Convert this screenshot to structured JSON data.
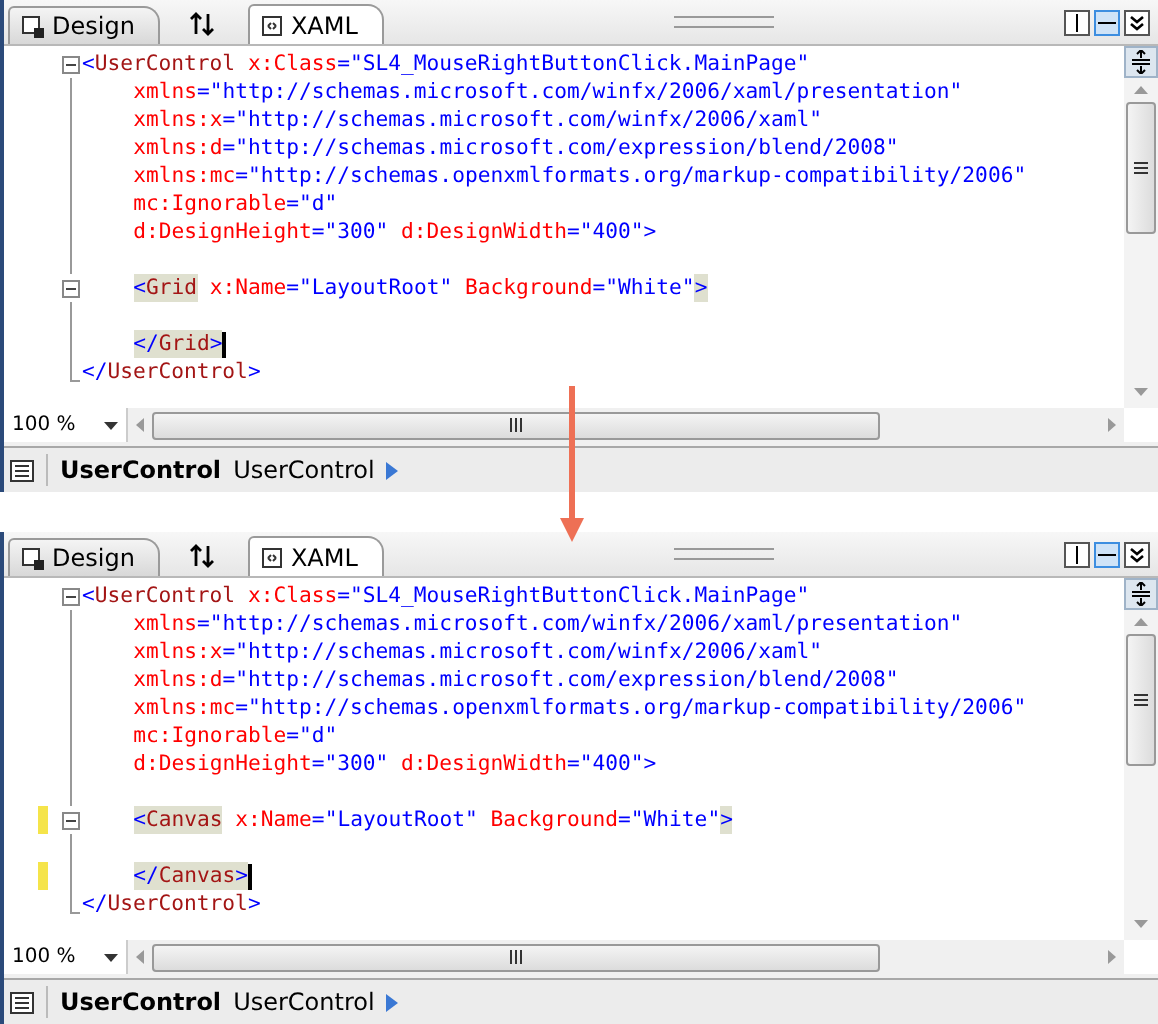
{
  "panels": [
    {
      "tabs": [
        {
          "label": "Design",
          "selected": false,
          "kind": "design"
        },
        {
          "label": "XAML",
          "selected": true,
          "kind": "xaml"
        }
      ],
      "lines": [
        {
          "kind": "fold_start",
          "indented": false,
          "changed": false,
          "tokens": [
            {
              "text": "<",
              "kind": "bracket"
            },
            {
              "text": "UserControl",
              "kind": "name"
            },
            {
              "text": " x:Class",
              "kind": "attr"
            },
            {
              "text": "=",
              "kind": "bracket"
            },
            {
              "text": "\"SL4_MouseRightButtonClick.MainPage\"",
              "kind": "value"
            }
          ]
        },
        {
          "kind": "fold_body",
          "indented": true,
          "changed": false,
          "tokens": [
            {
              "text": "xmlns",
              "kind": "attr"
            },
            {
              "text": "=",
              "kind": "bracket"
            },
            {
              "text": "\"http://schemas.microsoft.com/winfx/2006/xaml/presentation\"",
              "kind": "value"
            }
          ]
        },
        {
          "kind": "fold_body",
          "indented": true,
          "changed": false,
          "tokens": [
            {
              "text": "xmlns:x",
              "kind": "attr"
            },
            {
              "text": "=",
              "kind": "bracket"
            },
            {
              "text": "\"http://schemas.microsoft.com/winfx/2006/xaml\"",
              "kind": "value"
            }
          ]
        },
        {
          "kind": "fold_body",
          "indented": true,
          "changed": false,
          "tokens": [
            {
              "text": "xmlns:d",
              "kind": "attr"
            },
            {
              "text": "=",
              "kind": "bracket"
            },
            {
              "text": "\"http://schemas.microsoft.com/expression/blend/2008\"",
              "kind": "value"
            }
          ]
        },
        {
          "kind": "fold_body",
          "indented": true,
          "changed": false,
          "tokens": [
            {
              "text": "xmlns:mc",
              "kind": "attr"
            },
            {
              "text": "=",
              "kind": "bracket"
            },
            {
              "text": "\"http://schemas.openxmlformats.org/markup-compatibility/2006\"",
              "kind": "value"
            }
          ]
        },
        {
          "kind": "fold_body",
          "indented": true,
          "changed": false,
          "tokens": [
            {
              "text": "mc:Ignorable",
              "kind": "attr"
            },
            {
              "text": "=",
              "kind": "bracket"
            },
            {
              "text": "\"d\"",
              "kind": "value"
            }
          ]
        },
        {
          "kind": "fold_body",
          "indented": true,
          "changed": false,
          "tokens": [
            {
              "text": "d:DesignHeight",
              "kind": "attr"
            },
            {
              "text": "=",
              "kind": "bracket"
            },
            {
              "text": "\"300\"",
              "kind": "value"
            },
            {
              "text": " d:DesignWidth",
              "kind": "attr"
            },
            {
              "text": "=",
              "kind": "bracket"
            },
            {
              "text": "\"400\"",
              "kind": "value"
            },
            {
              "text": ">",
              "kind": "bracket"
            }
          ]
        },
        {
          "kind": "fold_body",
          "changed": false
        },
        {
          "kind": "fold_start",
          "indented": true,
          "changed": false,
          "tokens": [
            {
              "text": "<",
              "kind": "match_bracket"
            },
            {
              "text": "Grid",
              "kind": "match_name"
            },
            {
              "text": " x:Name",
              "kind": "attr"
            },
            {
              "text": "=",
              "kind": "bracket"
            },
            {
              "text": "\"LayoutRoot\"",
              "kind": "value"
            },
            {
              "text": " Background",
              "kind": "attr"
            },
            {
              "text": "=",
              "kind": "bracket"
            },
            {
              "text": "\"White\"",
              "kind": "value"
            },
            {
              "text": ">",
              "kind": "match_bracket"
            }
          ]
        },
        {
          "kind": "fold_body",
          "changed": false
        },
        {
          "kind": "fold_body",
          "indented": true,
          "changed": false,
          "tokens": [
            {
              "text": "</",
              "kind": "match_bracket"
            },
            {
              "text": "Grid",
              "kind": "match_name"
            },
            {
              "text": ">",
              "kind": "match_bracket"
            },
            {
              "kind": "caret"
            }
          ]
        },
        {
          "kind": "fold_end",
          "indented": false,
          "changed": false,
          "tokens": [
            {
              "text": "</",
              "kind": "bracket"
            },
            {
              "text": "UserControl",
              "kind": "name"
            },
            {
              "text": ">",
              "kind": "bracket"
            }
          ]
        }
      ],
      "zoom": "100 %",
      "breadcrumb": [
        {
          "text": "UserControl",
          "bold": true
        },
        {
          "text": "UserControl",
          "bold": false
        }
      ]
    },
    {
      "tabs": [
        {
          "label": "Design",
          "selected": false,
          "kind": "design"
        },
        {
          "label": "XAML",
          "selected": true,
          "kind": "xaml"
        }
      ],
      "lines": [
        {
          "kind": "fold_start",
          "indented": false,
          "changed": false,
          "tokens": [
            {
              "text": "<",
              "kind": "bracket"
            },
            {
              "text": "UserControl",
              "kind": "name"
            },
            {
              "text": " x:Class",
              "kind": "attr"
            },
            {
              "text": "=",
              "kind": "bracket"
            },
            {
              "text": "\"SL4_MouseRightButtonClick.MainPage\"",
              "kind": "value"
            }
          ]
        },
        {
          "kind": "fold_body",
          "indented": true,
          "changed": false,
          "tokens": [
            {
              "text": "xmlns",
              "kind": "attr"
            },
            {
              "text": "=",
              "kind": "bracket"
            },
            {
              "text": "\"http://schemas.microsoft.com/winfx/2006/xaml/presentation\"",
              "kind": "value"
            }
          ]
        },
        {
          "kind": "fold_body",
          "indented": true,
          "changed": false,
          "tokens": [
            {
              "text": "xmlns:x",
              "kind": "attr"
            },
            {
              "text": "=",
              "kind": "bracket"
            },
            {
              "text": "\"http://schemas.microsoft.com/winfx/2006/xaml\"",
              "kind": "value"
            }
          ]
        },
        {
          "kind": "fold_body",
          "indented": true,
          "changed": false,
          "tokens": [
            {
              "text": "xmlns:d",
              "kind": "attr"
            },
            {
              "text": "=",
              "kind": "bracket"
            },
            {
              "text": "\"http://schemas.microsoft.com/expression/blend/2008\"",
              "kind": "value"
            }
          ]
        },
        {
          "kind": "fold_body",
          "indented": true,
          "changed": false,
          "tokens": [
            {
              "text": "xmlns:mc",
              "kind": "attr"
            },
            {
              "text": "=",
              "kind": "bracket"
            },
            {
              "text": "\"http://schemas.openxmlformats.org/markup-compatibility/2006\"",
              "kind": "value"
            }
          ]
        },
        {
          "kind": "fold_body",
          "indented": true,
          "changed": false,
          "tokens": [
            {
              "text": "mc:Ignorable",
              "kind": "attr"
            },
            {
              "text": "=",
              "kind": "bracket"
            },
            {
              "text": "\"d\"",
              "kind": "value"
            }
          ]
        },
        {
          "kind": "fold_body",
          "indented": true,
          "changed": false,
          "tokens": [
            {
              "text": "d:DesignHeight",
              "kind": "attr"
            },
            {
              "text": "=",
              "kind": "bracket"
            },
            {
              "text": "\"300\"",
              "kind": "value"
            },
            {
              "text": " d:DesignWidth",
              "kind": "attr"
            },
            {
              "text": "=",
              "kind": "bracket"
            },
            {
              "text": "\"400\"",
              "kind": "value"
            },
            {
              "text": ">",
              "kind": "bracket"
            }
          ]
        },
        {
          "kind": "fold_body",
          "changed": false
        },
        {
          "kind": "fold_start",
          "indented": true,
          "changed": true,
          "tokens": [
            {
              "text": "<",
              "kind": "match_bracket"
            },
            {
              "text": "Canvas",
              "kind": "match_name"
            },
            {
              "text": " x:Name",
              "kind": "attr"
            },
            {
              "text": "=",
              "kind": "bracket"
            },
            {
              "text": "\"LayoutRoot\"",
              "kind": "value"
            },
            {
              "text": " Background",
              "kind": "attr"
            },
            {
              "text": "=",
              "kind": "bracket"
            },
            {
              "text": "\"White\"",
              "kind": "value"
            },
            {
              "text": ">",
              "kind": "match_bracket"
            }
          ]
        },
        {
          "kind": "fold_body",
          "changed": false
        },
        {
          "kind": "fold_body",
          "indented": true,
          "changed": true,
          "tokens": [
            {
              "text": "</",
              "kind": "match_bracket"
            },
            {
              "text": "Canvas",
              "kind": "match_name"
            },
            {
              "text": ">",
              "kind": "match_bracket"
            },
            {
              "kind": "caret"
            }
          ]
        },
        {
          "kind": "fold_end",
          "indented": false,
          "changed": false,
          "tokens": [
            {
              "text": "</",
              "kind": "bracket"
            },
            {
              "text": "UserControl",
              "kind": "name"
            },
            {
              "text": ">",
              "kind": "bracket"
            }
          ]
        }
      ],
      "zoom": "100 %",
      "breadcrumb": [
        {
          "text": "UserControl",
          "bold": true
        },
        {
          "text": "UserControl",
          "bold": false
        }
      ]
    }
  ]
}
